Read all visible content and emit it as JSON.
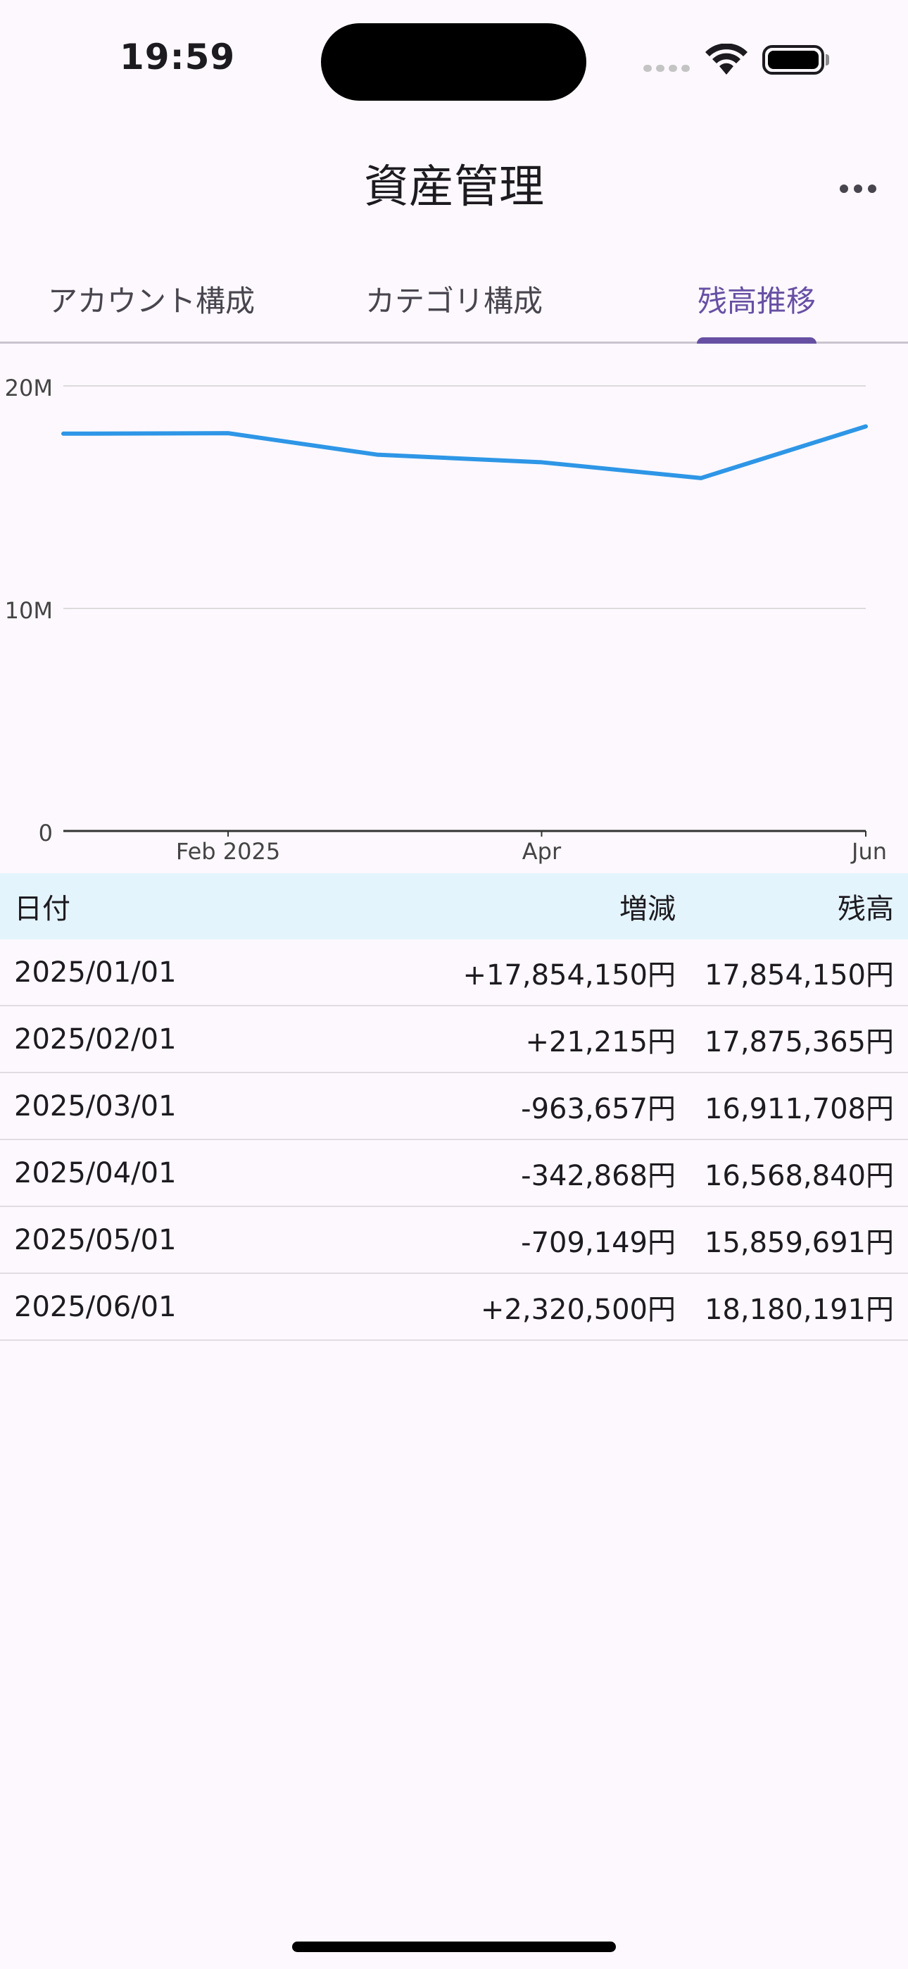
{
  "status_bar": {
    "time": "19:59"
  },
  "app_bar": {
    "title": "資産管理"
  },
  "tabs": [
    {
      "label": "アカウント構成",
      "active": false
    },
    {
      "label": "カテゴリ構成",
      "active": false
    },
    {
      "label": "残高推移",
      "active": true
    }
  ],
  "chart_data": {
    "type": "line",
    "x": [
      "2025-01-01",
      "2025-02-01",
      "2025-03-01",
      "2025-04-01",
      "2025-05-01",
      "2025-06-01"
    ],
    "x_tick_labels": [
      {
        "date": "2025-02-01",
        "label": "Feb 2025"
      },
      {
        "date": "2025-04-01",
        "label": "Apr"
      },
      {
        "date": "2025-06-01",
        "label": "Jun"
      }
    ],
    "series": [
      {
        "values": [
          17854150,
          17875365,
          16911708,
          16568840,
          15859691,
          18180191
        ],
        "color": "#2e96e6"
      }
    ],
    "y_ticks": [
      0,
      10000000,
      20000000
    ],
    "y_tick_labels": [
      "0",
      "10M",
      "20M"
    ],
    "ylim": [
      0,
      20000000
    ],
    "grid": true
  },
  "table": {
    "headers": {
      "date": "日付",
      "delta": "増減",
      "balance": "残高"
    },
    "rows": [
      {
        "date": "2025/01/01",
        "delta": "+17,854,150円",
        "balance": "17,854,150円"
      },
      {
        "date": "2025/02/01",
        "delta": "+21,215円",
        "balance": "17,875,365円"
      },
      {
        "date": "2025/03/01",
        "delta": "-963,657円",
        "balance": "16,911,708円"
      },
      {
        "date": "2025/04/01",
        "delta": "-342,868円",
        "balance": "16,568,840円"
      },
      {
        "date": "2025/05/01",
        "delta": "-709,149円",
        "balance": "15,859,691円"
      },
      {
        "date": "2025/06/01",
        "delta": "+2,320,500円",
        "balance": "18,180,191円"
      }
    ]
  }
}
